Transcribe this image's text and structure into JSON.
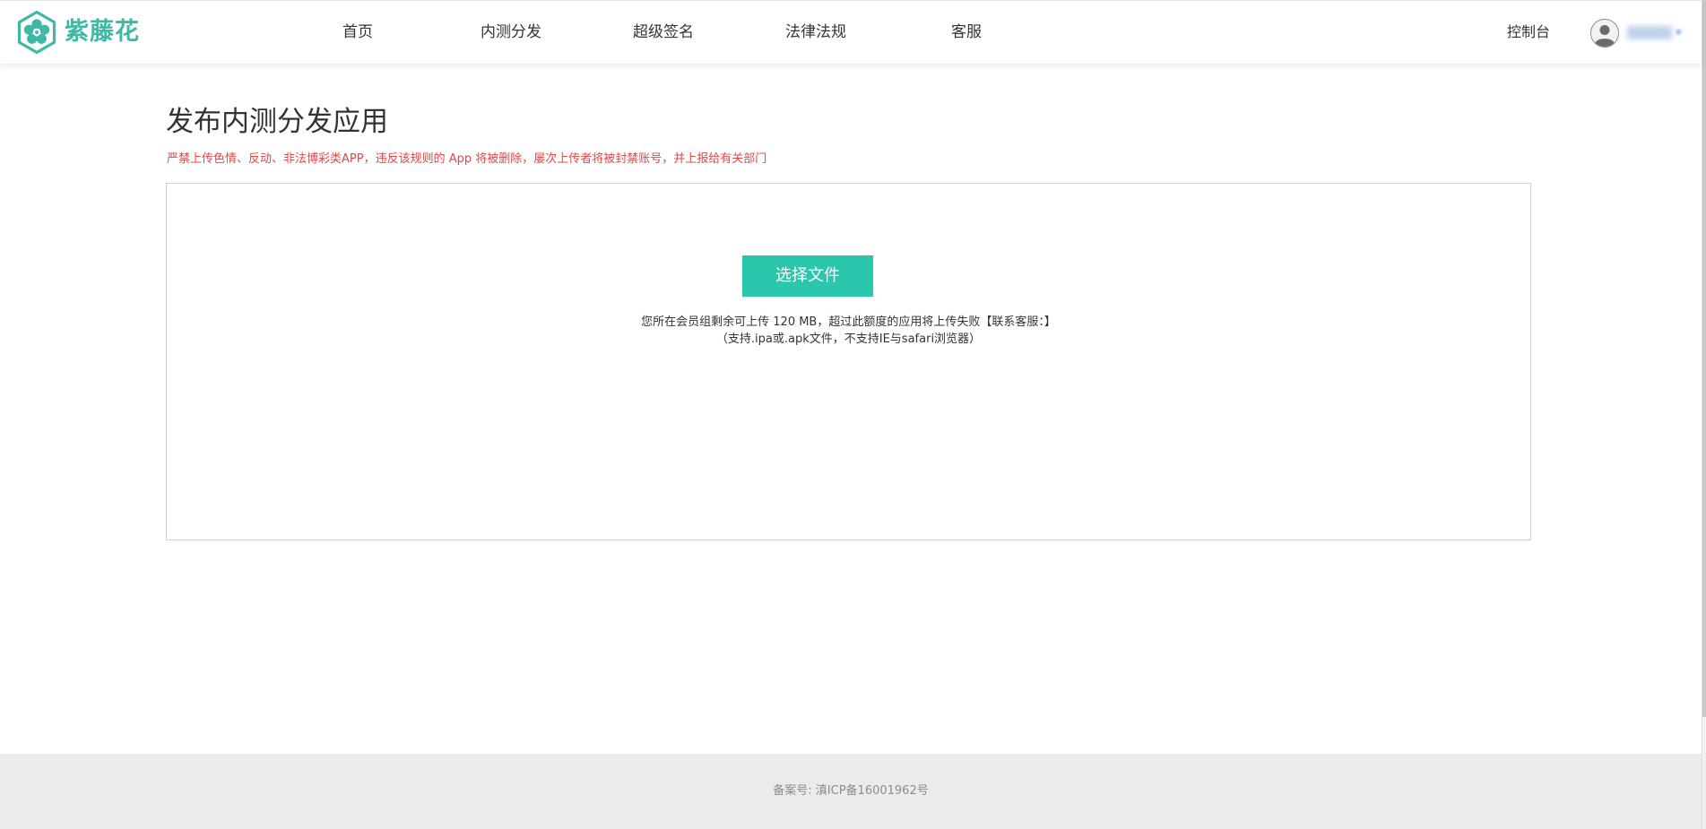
{
  "brand": {
    "name": "紫藤花",
    "color": "#3fb9a5",
    "icon": "flower-logo-icon"
  },
  "nav": {
    "items": [
      {
        "label": "首页"
      },
      {
        "label": "内测分发"
      },
      {
        "label": "超级签名"
      },
      {
        "label": "法律法规"
      },
      {
        "label": "客服"
      }
    ],
    "console_label": "控制台"
  },
  "user": {
    "avatar_icon": "user-avatar-icon",
    "name": "▒▒▒▒▒",
    "caret_icon": "chevron-down-icon"
  },
  "main": {
    "title": "发布内测分发应用",
    "warning": "严禁上传色情、反动、非法博彩类APP，违反该规则的 App 将被删除，屡次上传者将被封禁账号，并上报给有关部门",
    "warning_color": "#e04848",
    "upload": {
      "button_label": "选择文件",
      "button_color": "#2bc7ac",
      "quota_text": "您所在会员组剩余可上传 120 MB，超过此额度的应用将上传失败【联系客服：】",
      "support_text": "（支持.ipa或.apk文件，不支持IE与safari浏览器）"
    }
  },
  "footer": {
    "icp": "备案号: 滇ICP备16001962号"
  }
}
